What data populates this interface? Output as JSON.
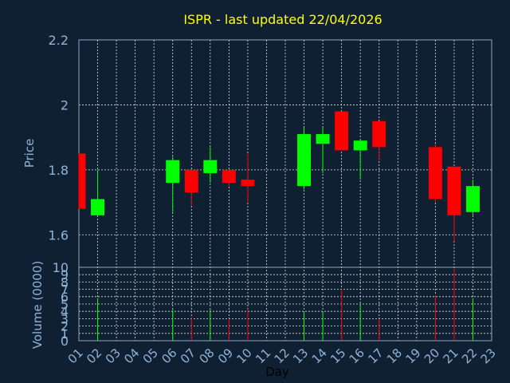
{
  "chart_data": {
    "type": "candlestick",
    "title": "ISPR - last updated 22/04/2026",
    "xlabel": "Day",
    "x_ticks": [
      "01",
      "02",
      "03",
      "04",
      "05",
      "06",
      "07",
      "08",
      "09",
      "10",
      "11",
      "12",
      "13",
      "14",
      "15",
      "16",
      "17",
      "18",
      "19",
      "20",
      "21",
      "22",
      "23"
    ],
    "price_panel": {
      "ylabel": "Price",
      "ylim": [
        1.5,
        2.2
      ],
      "y_ticks": [
        {
          "label": "2.2",
          "value": 2.2
        },
        {
          "label": "2",
          "value": 2.0
        },
        {
          "label": "1.8",
          "value": 1.8
        },
        {
          "label": "1.6",
          "value": 1.6
        }
      ],
      "grid": true
    },
    "volume_panel": {
      "ylabel": "Volume (0000)",
      "ylim": [
        0,
        10
      ],
      "y_ticks": [
        "0",
        "1",
        "2",
        "3",
        "4",
        "5",
        "6",
        "7",
        "8",
        "9",
        "10"
      ],
      "grid": true
    },
    "up_color": "#00ff00",
    "down_color": "#ff0000",
    "candles": [
      {
        "day": 1,
        "open": 1.85,
        "close": 1.68,
        "high": 1.85,
        "low": 1.68
      },
      {
        "day": 2,
        "open": 1.66,
        "close": 1.71,
        "high": 1.8,
        "low": 1.66
      },
      {
        "day": 6,
        "open": 1.76,
        "close": 1.83,
        "high": 1.84,
        "low": 1.67
      },
      {
        "day": 7,
        "open": 1.8,
        "close": 1.73,
        "high": 1.8,
        "low": 1.69
      },
      {
        "day": 8,
        "open": 1.79,
        "close": 1.83,
        "high": 1.87,
        "low": 1.76
      },
      {
        "day": 9,
        "open": 1.8,
        "close": 1.76,
        "high": 1.8,
        "low": 1.75
      },
      {
        "day": 10,
        "open": 1.77,
        "close": 1.75,
        "high": 1.85,
        "low": 1.7
      },
      {
        "day": 13,
        "open": 1.75,
        "close": 1.91,
        "high": 1.93,
        "low": 1.74
      },
      {
        "day": 14,
        "open": 1.88,
        "close": 1.91,
        "high": 1.93,
        "low": 1.79
      },
      {
        "day": 15,
        "open": 1.98,
        "close": 1.86,
        "high": 1.98,
        "low": 1.86
      },
      {
        "day": 16,
        "open": 1.86,
        "close": 1.89,
        "high": 1.89,
        "low": 1.77
      },
      {
        "day": 17,
        "open": 1.95,
        "close": 1.87,
        "high": 1.95,
        "low": 1.83
      },
      {
        "day": 20,
        "open": 1.87,
        "close": 1.71,
        "high": 1.88,
        "low": 1.7
      },
      {
        "day": 21,
        "open": 1.81,
        "close": 1.66,
        "high": 1.81,
        "low": 1.58
      },
      {
        "day": 22,
        "open": 1.67,
        "close": 1.75,
        "high": 1.77,
        "low": 1.66
      }
    ],
    "volume": [
      {
        "day": 2,
        "value": 5.8,
        "direction": "up"
      },
      {
        "day": 6,
        "value": 4.2,
        "direction": "up"
      },
      {
        "day": 7,
        "value": 3.2,
        "direction": "down"
      },
      {
        "day": 8,
        "value": 4.3,
        "direction": "up"
      },
      {
        "day": 9,
        "value": 3.0,
        "direction": "down"
      },
      {
        "day": 10,
        "value": 4.3,
        "direction": "down"
      },
      {
        "day": 13,
        "value": 4.0,
        "direction": "up"
      },
      {
        "day": 14,
        "value": 4.0,
        "direction": "up"
      },
      {
        "day": 15,
        "value": 7.0,
        "direction": "down"
      },
      {
        "day": 16,
        "value": 5.0,
        "direction": "up"
      },
      {
        "day": 17,
        "value": 3.0,
        "direction": "down"
      },
      {
        "day": 20,
        "value": 6.2,
        "direction": "down"
      },
      {
        "day": 21,
        "value": 9.8,
        "direction": "down"
      },
      {
        "day": 22,
        "value": 5.8,
        "direction": "up"
      }
    ]
  },
  "colors": {
    "background": "#0f2033",
    "title": "#ffff00",
    "axis_text": "#8fb4d8",
    "xlabel_text": "#000000",
    "grid": "#e0e0e0",
    "frame": "#8fa9c4"
  }
}
